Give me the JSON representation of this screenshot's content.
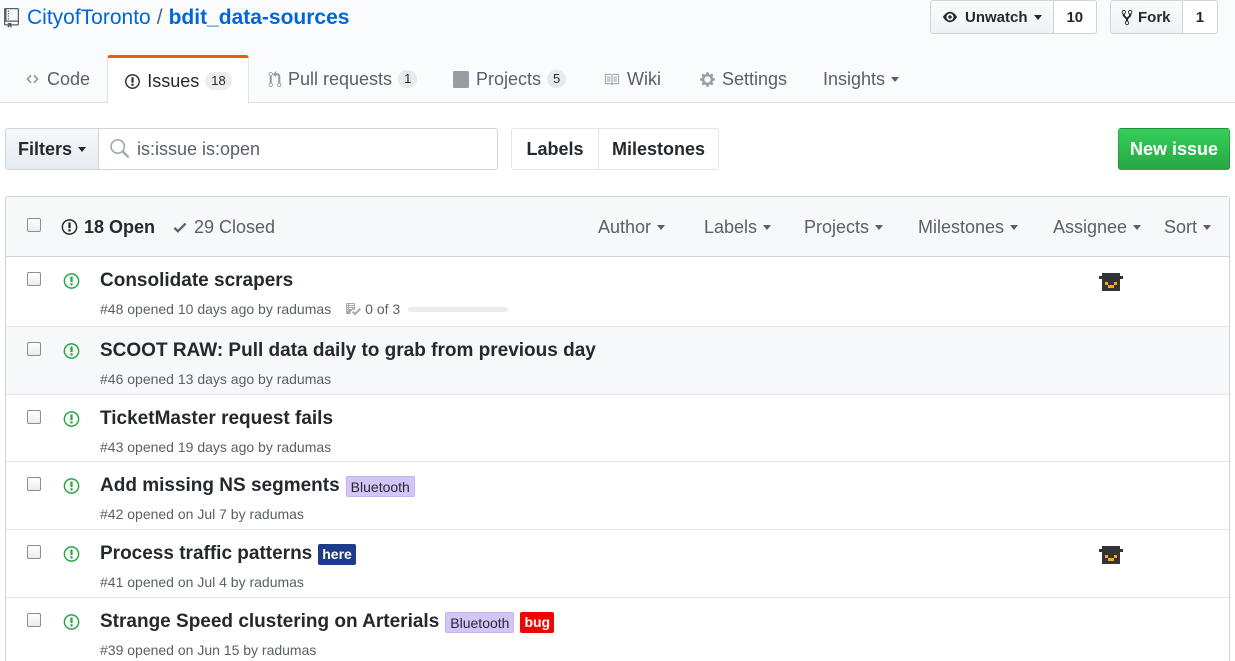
{
  "repo": {
    "owner": "CityofToronto",
    "separator": "/",
    "name": "bdit_data-sources"
  },
  "actions": {
    "unwatch_label": "Unwatch",
    "watch_count": "10",
    "fork_label": "Fork",
    "fork_count": "1"
  },
  "tabs": [
    {
      "label": "Code",
      "icon": "code-icon",
      "count": ""
    },
    {
      "label": "Issues",
      "icon": "issue-opened-icon",
      "count": "18"
    },
    {
      "label": "Pull requests",
      "icon": "git-pull-request-icon",
      "count": "1"
    },
    {
      "label": "Projects",
      "icon": "project-icon",
      "count": "5"
    },
    {
      "label": "Wiki",
      "icon": "book-icon",
      "count": ""
    },
    {
      "label": "Settings",
      "icon": "gear-icon",
      "count": ""
    },
    {
      "label": "Insights",
      "icon": "",
      "count": ""
    }
  ],
  "subnav": {
    "filters_label": "Filters",
    "search_value": "is:issue is:open",
    "labels_label": "Labels",
    "milestones_label": "Milestones",
    "new_issue_label": "New issue"
  },
  "list_header": {
    "open": "18 Open",
    "closed": "29 Closed",
    "filters": [
      "Author",
      "Labels",
      "Projects",
      "Milestones",
      "Assignee",
      "Sort"
    ]
  },
  "issues": [
    {
      "title": "Consolidate scrapers",
      "meta": "#48 opened 10 days ago by radumas",
      "tasks": "0 of 3",
      "labels": [],
      "assignee": true
    },
    {
      "title": "SCOOT RAW: Pull data daily to grab from previous day",
      "meta": "#46 opened 13 days ago by radumas",
      "labels": [],
      "assignee": false
    },
    {
      "title": "TicketMaster request fails",
      "meta": "#43 opened 19 days ago by radumas",
      "labels": [],
      "assignee": false
    },
    {
      "title": "Add missing NS segments",
      "meta": "#42 opened on Jul 7 by radumas",
      "labels": [
        {
          "name": "Bluetooth",
          "color": "#d4c5f9"
        }
      ],
      "assignee": false
    },
    {
      "title": "Process traffic patterns",
      "meta": "#41 opened on Jul 4 by radumas",
      "labels": [
        {
          "name": "here",
          "color": "#1d3c8c"
        }
      ],
      "assignee": true
    },
    {
      "title": "Strange Speed clustering on Arterials",
      "meta": "#39 opened on Jun 15 by radumas",
      "labels": [
        {
          "name": "Bluetooth",
          "color": "#d4c5f9"
        },
        {
          "name": "bug",
          "color": "#ee0701"
        }
      ],
      "assignee": false
    }
  ],
  "colors": {
    "link": "#0366d6",
    "open_green": "#28a745",
    "tab_accent": "#e36209"
  }
}
